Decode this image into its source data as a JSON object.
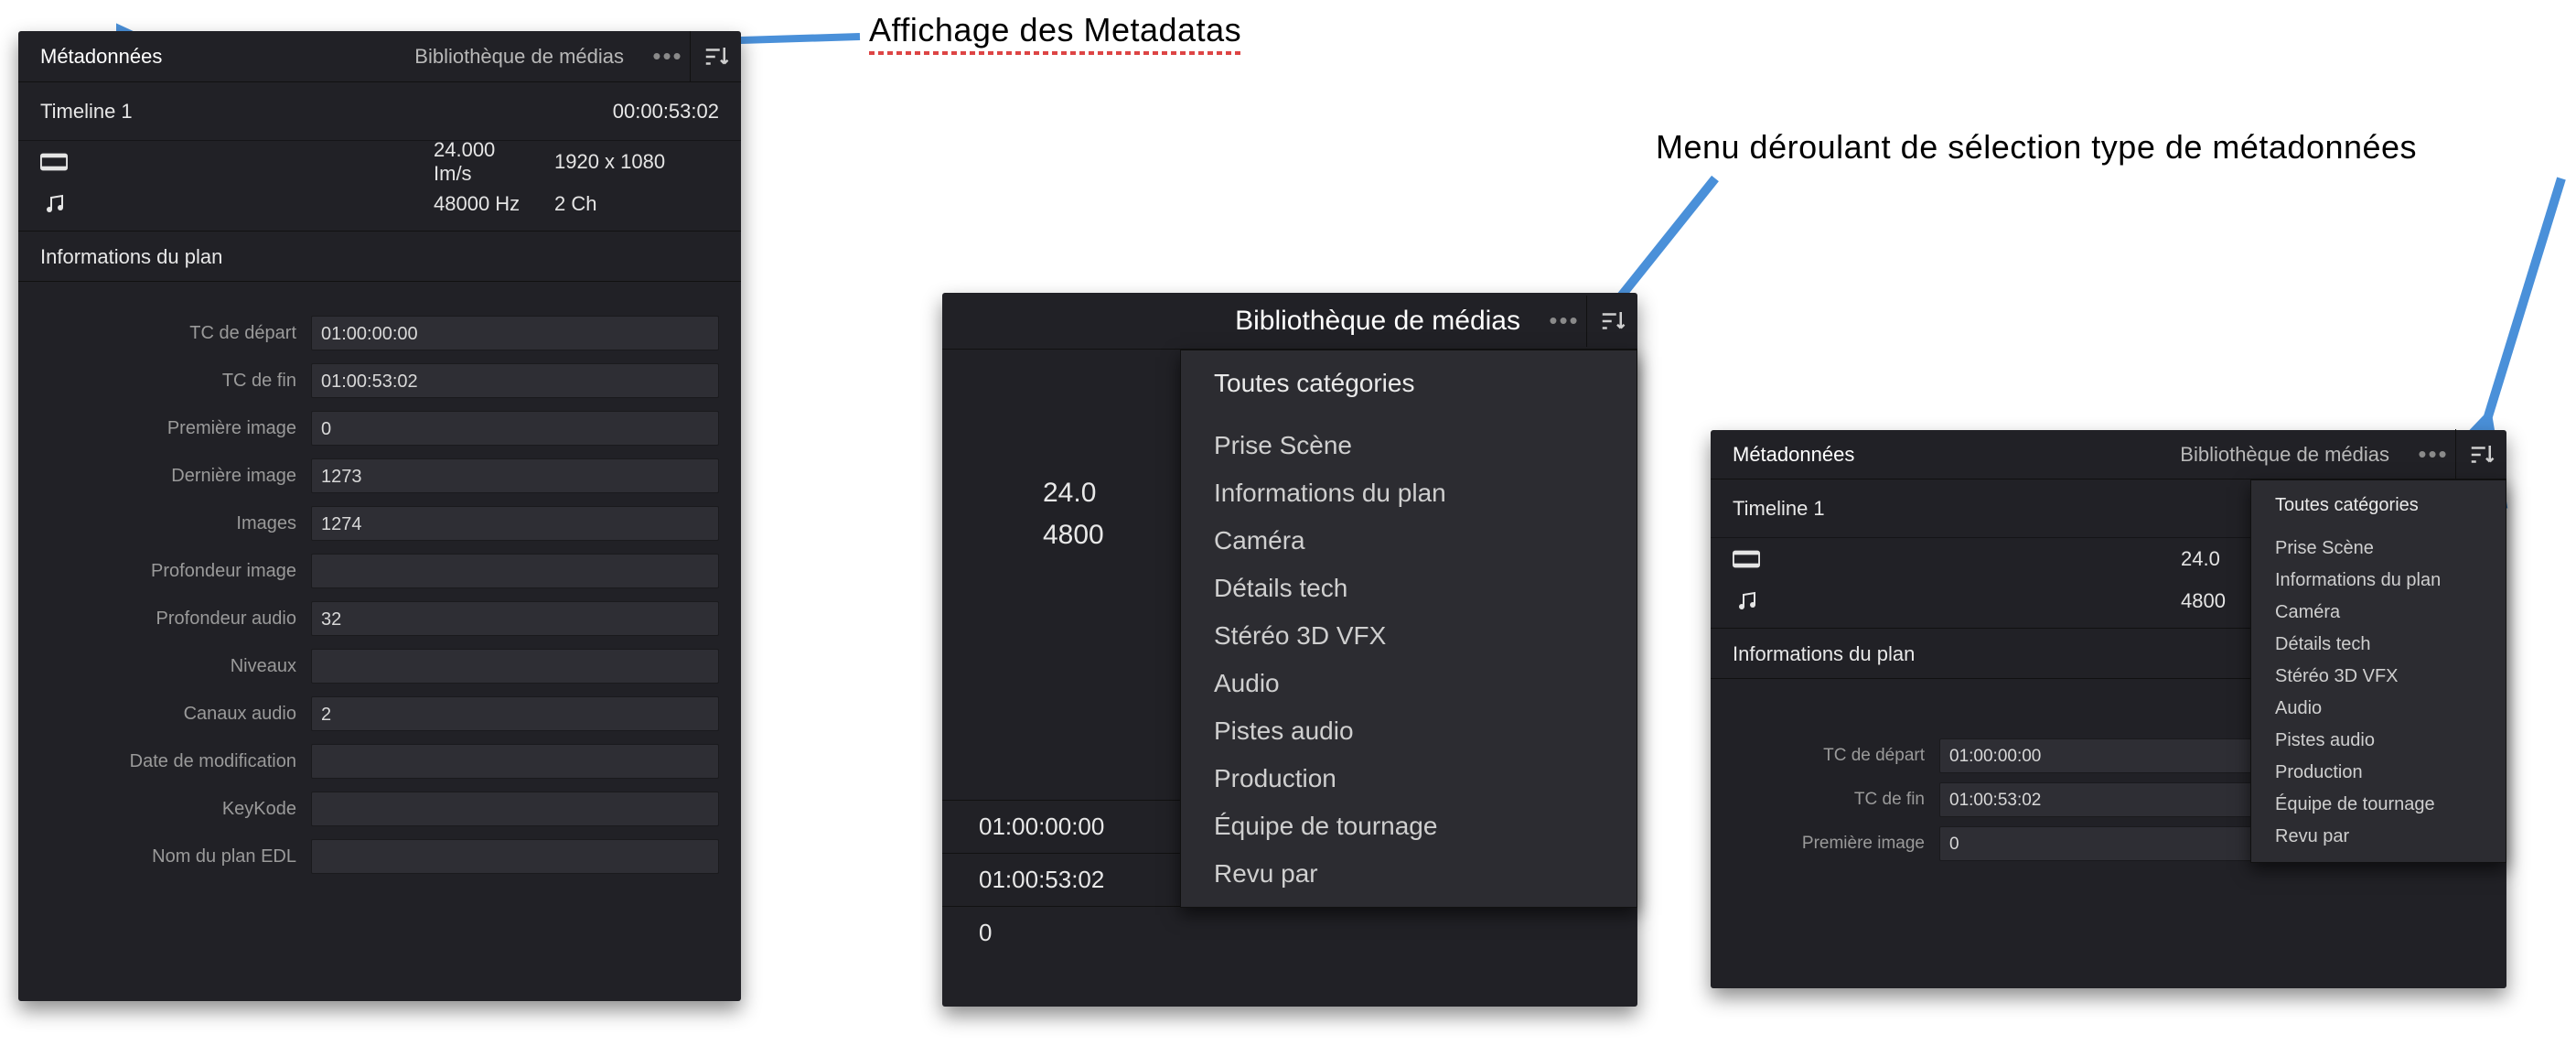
{
  "annotations": {
    "display": "Affichage des Metadatas",
    "dropdown": "Menu déroulant de sélection type de métadonnées"
  },
  "panelA": {
    "tabs": {
      "meta": "Métadonnées",
      "lib": "Bibliothèque de médias"
    },
    "timeline": {
      "name": "Timeline 1",
      "tc": "00:00:53:02"
    },
    "video": {
      "fps": "24.000 Im/s",
      "res": "1920 x 1080"
    },
    "audio": {
      "hz": "48000 Hz",
      "ch": "2 Ch"
    },
    "section": "Informations du plan",
    "fields": [
      {
        "label": "TC de départ",
        "value": "01:00:00:00"
      },
      {
        "label": "TC de fin",
        "value": "01:00:53:02"
      },
      {
        "label": "Première image",
        "value": "0"
      },
      {
        "label": "Dernière image",
        "value": "1273"
      },
      {
        "label": "Images",
        "value": "1274"
      },
      {
        "label": "Profondeur image",
        "value": ""
      },
      {
        "label": "Profondeur audio",
        "value": "32"
      },
      {
        "label": "Niveaux",
        "value": ""
      },
      {
        "label": "Canaux audio",
        "value": "2"
      },
      {
        "label": "Date de modification",
        "value": ""
      },
      {
        "label": "KeyKode",
        "value": ""
      },
      {
        "label": "Nom du plan EDL",
        "value": ""
      }
    ]
  },
  "panelB": {
    "tab": "Bibliothèque de médias",
    "vals": {
      "fps": "24.0",
      "hz": "4800"
    },
    "bottom": {
      "tc1": "01:00:00:00",
      "tc2": "01:00:53:02",
      "n": "0"
    },
    "menu": [
      "Toutes catégories",
      "Prise  Scène",
      "Informations du plan",
      "Caméra",
      "Détails tech",
      "Stéréo 3D  VFX",
      "Audio",
      "Pistes audio",
      "Production",
      "Équipe de tournage",
      "Revu par"
    ]
  },
  "panelC": {
    "tabs": {
      "meta": "Métadonnées",
      "lib": "Bibliothèque de médias"
    },
    "timeline": {
      "name": "Timeline 1"
    },
    "video": {
      "fps": "24.0"
    },
    "audio": {
      "hz": "4800"
    },
    "section": "Informations du plan",
    "fields": [
      {
        "label": "TC de départ",
        "value": "01:00:00:00"
      },
      {
        "label": "TC de fin",
        "value": "01:00:53:02"
      },
      {
        "label": "Première image",
        "value": "0"
      }
    ],
    "menu": [
      "Toutes catégories",
      "Prise  Scène",
      "Informations du plan",
      "Caméra",
      "Détails tech",
      "Stéréo 3D  VFX",
      "Audio",
      "Pistes audio",
      "Production",
      "Équipe de tournage",
      "Revu par"
    ]
  }
}
